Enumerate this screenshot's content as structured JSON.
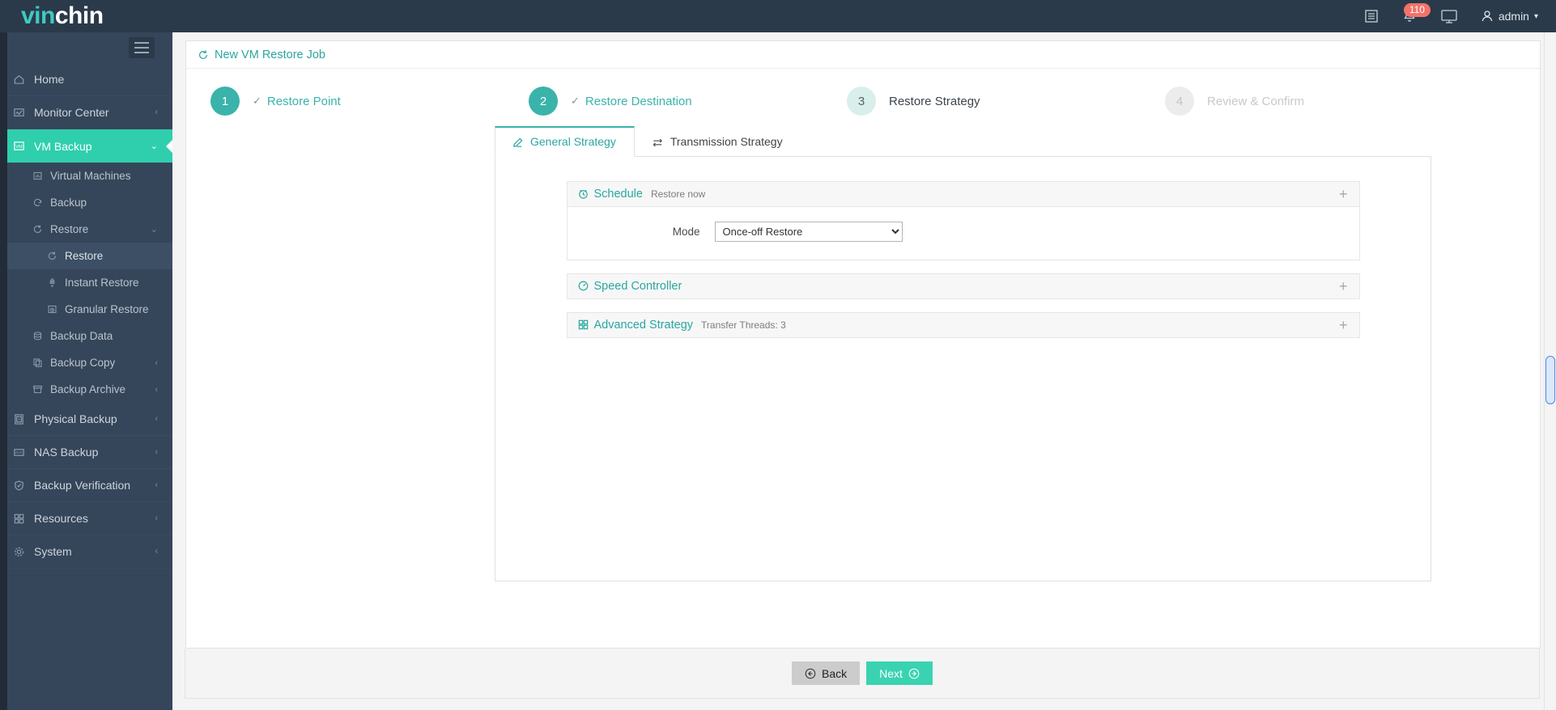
{
  "brand": {
    "part1": "vin",
    "part2": "chin"
  },
  "topbar": {
    "notification_count": "110",
    "user_label": "admin",
    "icons": [
      "list-icon",
      "bell-icon",
      "monitor-icon",
      "user-icon",
      "chevron-down-icon"
    ]
  },
  "sidebar": {
    "items": [
      {
        "label": "Home",
        "icon": "home-icon",
        "arrow": "",
        "level": 0,
        "active": false
      },
      {
        "label": "Monitor Center",
        "icon": "monitor-chart-icon",
        "arrow": "‹",
        "level": 0,
        "active": false
      },
      {
        "label": "VM Backup",
        "icon": "vm-icon",
        "arrow": "⌄",
        "level": 0,
        "active": true
      },
      {
        "label": "Virtual Machines",
        "icon": "grid-icon",
        "arrow": "",
        "level": 1,
        "active": false
      },
      {
        "label": "Backup",
        "icon": "refresh-icon",
        "arrow": "",
        "level": 1,
        "active": false
      },
      {
        "label": "Restore",
        "icon": "restore-icon",
        "arrow": "⌄",
        "level": 1,
        "active": false
      },
      {
        "label": "Restore",
        "icon": "restore-icon",
        "arrow": "",
        "level": 2,
        "active": true
      },
      {
        "label": "Instant Restore",
        "icon": "rocket-icon",
        "arrow": "",
        "level": 2,
        "active": false
      },
      {
        "label": "Granular Restore",
        "icon": "archive-clock-icon",
        "arrow": "",
        "level": 2,
        "active": false
      },
      {
        "label": "Backup Data",
        "icon": "database-icon",
        "arrow": "",
        "level": 1,
        "active": false
      },
      {
        "label": "Backup Copy",
        "icon": "copy-icon",
        "arrow": "‹",
        "level": 1,
        "active": false
      },
      {
        "label": "Backup Archive",
        "icon": "archive-icon",
        "arrow": "‹",
        "level": 1,
        "active": false
      },
      {
        "label": "Physical Backup",
        "icon": "server-icon",
        "arrow": "‹",
        "level": 0,
        "active": false
      },
      {
        "label": "NAS Backup",
        "icon": "nas-icon",
        "arrow": "‹",
        "level": 0,
        "active": false
      },
      {
        "label": "Backup Verification",
        "icon": "shield-check-icon",
        "arrow": "‹",
        "level": 0,
        "active": false
      },
      {
        "label": "Resources",
        "icon": "blocks-icon",
        "arrow": "‹",
        "level": 0,
        "active": false
      },
      {
        "label": "System",
        "icon": "gear-icon",
        "arrow": "‹",
        "level": 0,
        "active": false
      }
    ]
  },
  "page": {
    "title": "New VM Restore Job",
    "title_icon": "restore-icon"
  },
  "wizard": {
    "steps": [
      {
        "num": "1",
        "label": "Restore Point",
        "state": "done"
      },
      {
        "num": "2",
        "label": "Restore Destination",
        "state": "done"
      },
      {
        "num": "3",
        "label": "Restore Strategy",
        "state": "current"
      },
      {
        "num": "4",
        "label": "Review & Confirm",
        "state": "todo"
      }
    ]
  },
  "tabs": [
    {
      "label": "General Strategy",
      "icon": "pencil-icon",
      "active": true
    },
    {
      "label": "Transmission Strategy",
      "icon": "transfer-icon",
      "active": false
    }
  ],
  "panels": [
    {
      "title": "Schedule",
      "icon": "clock-icon",
      "summary": "Restore now",
      "toggle": "+",
      "expanded": true,
      "field_label": "Mode",
      "field_value": "Once-off Restore",
      "field_options": [
        "Once-off Restore"
      ]
    },
    {
      "title": "Speed Controller",
      "icon": "speed-icon",
      "summary": "",
      "toggle": "+",
      "expanded": false
    },
    {
      "title": "Advanced Strategy",
      "icon": "blocks-icon",
      "summary": "Transfer Threads: 3",
      "toggle": "+",
      "expanded": false
    }
  ],
  "footer": {
    "back_label": "Back",
    "next_label": "Next",
    "back_icon": "arrow-left-circle-icon",
    "next_icon": "arrow-right-circle-icon"
  },
  "colors": {
    "accent_teal": "#3ab3ab",
    "sidebar_bg": "#36465a",
    "topbar_bg": "#2b3a4a",
    "active_green": "#2fcfad",
    "badge_red": "#f4726a",
    "next_button": "#3ad3b1"
  }
}
